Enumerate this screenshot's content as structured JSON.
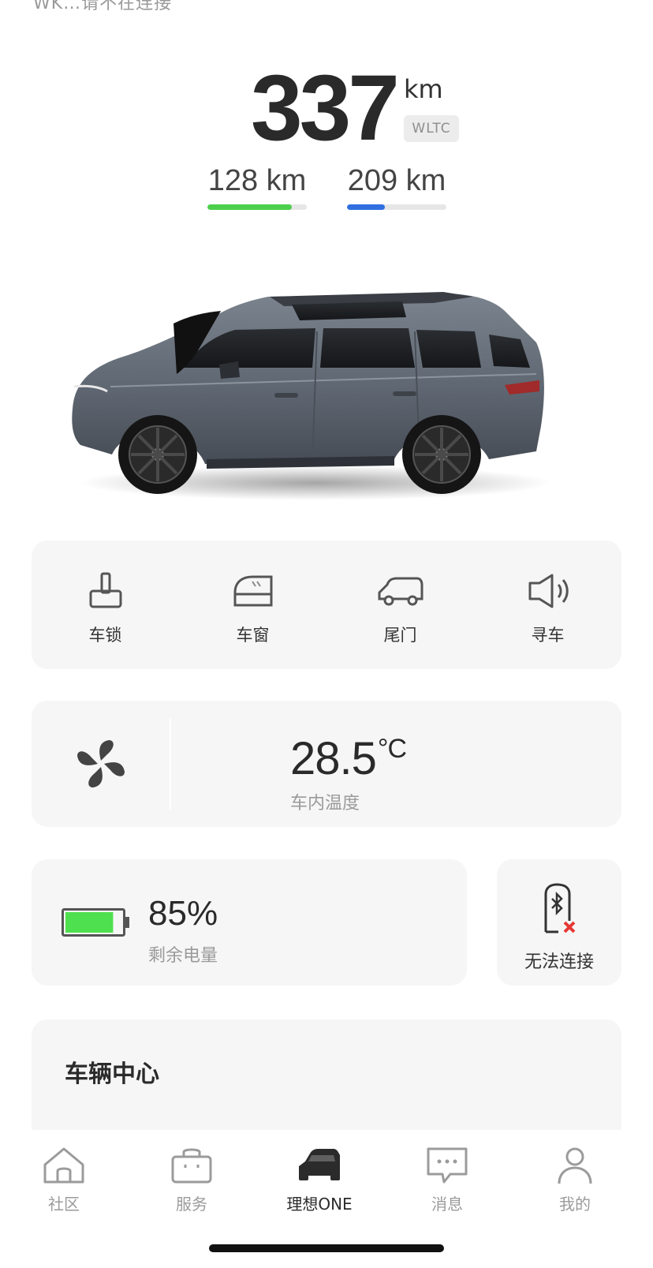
{
  "status_line": "WK…请不在连接",
  "range": {
    "value": "337",
    "unit": "km",
    "standard": "WLTC",
    "electric": {
      "label": "128 km",
      "fraction": 0.85,
      "color": "#4cd04c"
    },
    "fuel": {
      "label": "209 km",
      "fraction": 0.38,
      "color": "#2f6fe0"
    }
  },
  "controls": [
    {
      "label": "车锁",
      "icon": "lock-icon"
    },
    {
      "label": "车窗",
      "icon": "window-icon"
    },
    {
      "label": "尾门",
      "icon": "tailgate-icon"
    },
    {
      "label": "寻车",
      "icon": "find-car-speaker-icon"
    }
  ],
  "climate": {
    "temperature": "28.5",
    "unit": "°C",
    "label": "车内温度",
    "icon": "fan-icon"
  },
  "battery": {
    "percent": "85%",
    "level": 0.85,
    "label": "剩余电量",
    "color": "#4ee04e"
  },
  "bluetooth": {
    "label": "无法连接",
    "icon": "bluetooth-key-disconnected-icon",
    "error_color": "#e53935"
  },
  "vehicle_center": {
    "title": "车辆中心"
  },
  "tabs": [
    {
      "label": "社区",
      "icon": "home-icon",
      "active": false
    },
    {
      "label": "服务",
      "icon": "shopping-bag-icon",
      "active": false
    },
    {
      "label": "理想ONE",
      "icon": "car-icon",
      "active": true
    },
    {
      "label": "消息",
      "icon": "message-icon",
      "active": false
    },
    {
      "label": "我的",
      "icon": "person-icon",
      "active": false
    }
  ]
}
